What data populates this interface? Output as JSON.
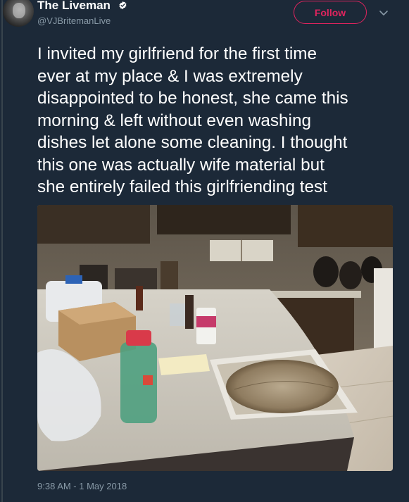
{
  "tweet": {
    "author": {
      "display_name": "The Liveman",
      "handle": "@VJBritemanLive",
      "avatar_icon": "avatar-photo",
      "badge_icon": "verified-badge-icon"
    },
    "follow_label": "Follow",
    "menu_icon": "chevron-down-icon",
    "text_lines": [
      "I invited my girlfriend for the first time",
      "ever at my place & I was extremely",
      "disappointed to be honest, she came this",
      "morning & left without even washing",
      "dishes let alone some cleaning. I thought",
      "this one was actually wife material but",
      "she entirely failed this girlfriending test"
    ],
    "timestamp": "9:38 AM - 1 May 2018"
  },
  "colors": {
    "background": "#1c2938",
    "text_primary": "#ffffff",
    "text_secondary": "#8899a6",
    "follow_accent": "#e0245e"
  }
}
